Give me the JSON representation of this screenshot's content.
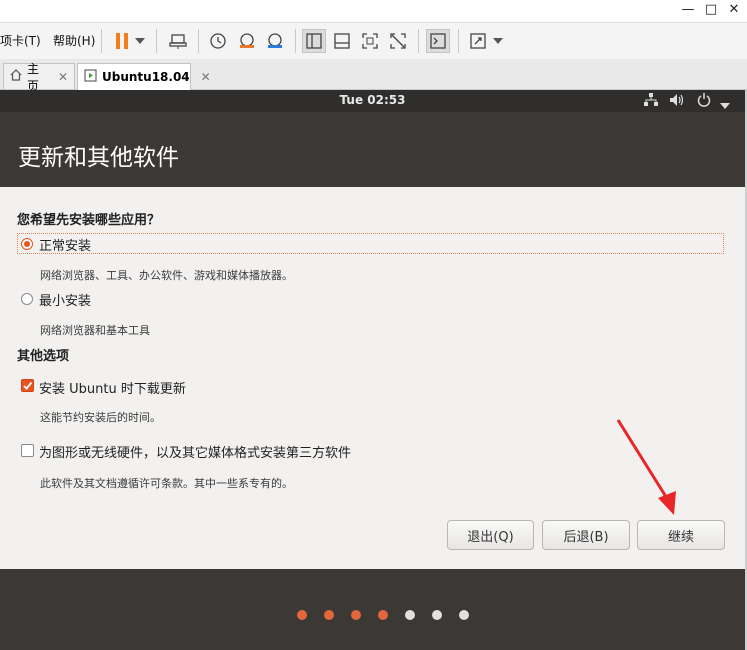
{
  "toolbar": {
    "menu_tabs": "项卡(T)",
    "menu_help": "帮助(H)"
  },
  "tabs": [
    {
      "label": "主页",
      "close": "✕"
    },
    {
      "label": "Ubuntu18.04",
      "close": "✕"
    }
  ],
  "vm": {
    "clock": "Tue 02:53",
    "header_title": "更新和其他软件",
    "question": "您希望先安装哪些应用？",
    "options": [
      {
        "label": "正常安装",
        "description": "网络浏览器、工具、办公软件、游戏和媒体播放器。",
        "selected": true
      },
      {
        "label": "最小安装",
        "description": "网络浏览器和基本工具",
        "selected": false
      }
    ],
    "other_section": "其他选项",
    "checkboxes": [
      {
        "label": "安装 Ubuntu 时下载更新",
        "description": "这能节约安装后的时间。",
        "checked": true
      },
      {
        "label": "为图形或无线硬件，以及其它媒体格式安装第三方软件",
        "description": "此软件及其文档遵循许可条款。其中一些系专有的。",
        "checked": false
      }
    ],
    "buttons": {
      "quit": "退出(Q)",
      "back": "后退(B)",
      "continue": "继续"
    },
    "progress_dots": {
      "total": 7,
      "done": 4
    }
  },
  "colors": {
    "accent": "#e95420",
    "dot_done": "#e2683c",
    "dot_pending": "#e0e0e0",
    "annotation_arrow": "#e8262a"
  }
}
